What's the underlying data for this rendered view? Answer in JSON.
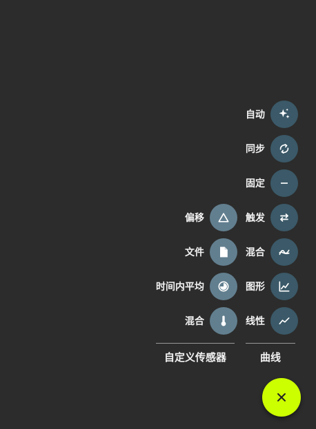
{
  "curve_group": {
    "title": "曲线",
    "items": [
      {
        "label": "自动",
        "icon": "sparkle-icon"
      },
      {
        "label": "同步",
        "icon": "sync-icon"
      },
      {
        "label": "固定",
        "icon": "minus-icon"
      },
      {
        "label": "触发",
        "icon": "swap-arrows-icon"
      },
      {
        "label": "混合",
        "icon": "blend-curve-icon"
      },
      {
        "label": "图形",
        "icon": "line-graph-icon"
      },
      {
        "label": "线性",
        "icon": "trending-line-icon"
      }
    ]
  },
  "custom_sensor_group": {
    "title": "自定义传感器",
    "items": [
      {
        "label": "偏移",
        "icon": "delta-triangle-icon"
      },
      {
        "label": "文件",
        "icon": "file-icon"
      },
      {
        "label": "时间内平均",
        "icon": "clock-average-icon"
      },
      {
        "label": "混合",
        "icon": "thermometer-icon"
      }
    ]
  },
  "fab": {
    "icon": "close-icon"
  },
  "colors": {
    "background": "#2c2c2c",
    "curve_button": "#3b5968",
    "custom_button": "#627f8f",
    "fab": "#ccff00"
  }
}
